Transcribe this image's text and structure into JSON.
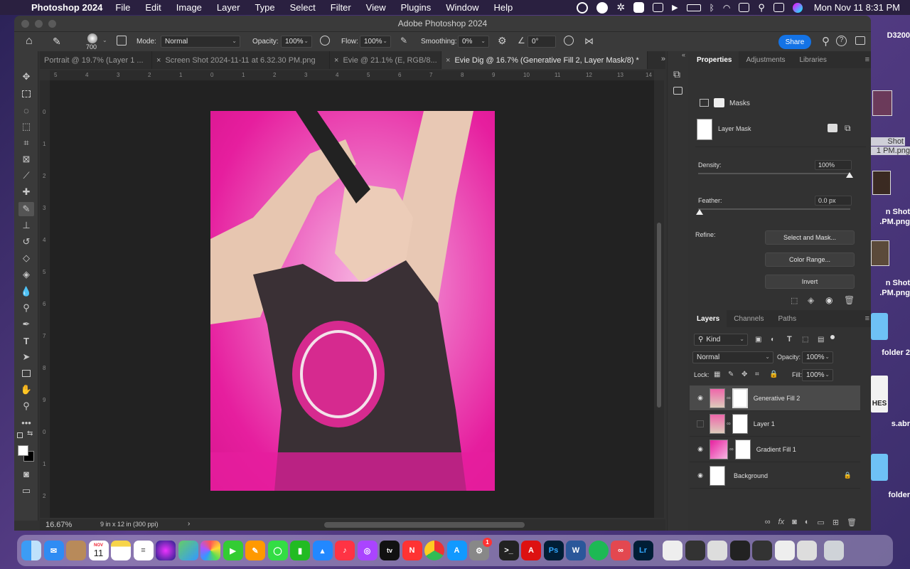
{
  "menubar": {
    "app_name": "Photoshop 2024",
    "menus": [
      "File",
      "Edit",
      "Image",
      "Layer",
      "Type",
      "Select",
      "Filter",
      "View",
      "Plugins",
      "Window",
      "Help"
    ],
    "datetime": "Mon Nov 11  8:31 PM"
  },
  "window": {
    "title": "Adobe Photoshop 2024"
  },
  "options": {
    "brush_size": "700",
    "mode_label": "Mode:",
    "mode_value": "Normal",
    "opacity_label": "Opacity:",
    "opacity_value": "100%",
    "flow_label": "Flow:",
    "flow_value": "100%",
    "smoothing_label": "Smoothing:",
    "smoothing_value": "0%",
    "angle_value": "0°",
    "share_label": "Share"
  },
  "tabs": [
    {
      "label": "Portrait @ 19.7% (Layer 1 ..."
    },
    {
      "label": "Screen Shot 2024-11-11 at 6.32.30 PM.png"
    },
    {
      "label": "Evie @ 21.1% (E, RGB/8..."
    },
    {
      "label": "Evie Dig @ 16.7% (Generative Fill 2, Layer Mask/8) *"
    }
  ],
  "ruler": {
    "h_ticks": [
      "5",
      "4",
      "3",
      "2",
      "1",
      "0",
      "1",
      "2",
      "3",
      "4",
      "5",
      "6",
      "7",
      "8",
      "9",
      "10",
      "11",
      "12",
      "13",
      "14"
    ],
    "v_ticks": [
      "0",
      "1",
      "2",
      "3",
      "4",
      "5",
      "6",
      "7",
      "8",
      "9",
      "0",
      "1",
      "2"
    ]
  },
  "status": {
    "zoom": "16.67%",
    "doc_info": "9 in x 12 in (300 ppi)"
  },
  "properties": {
    "tabs": [
      "Properties",
      "Adjustments",
      "Libraries"
    ],
    "masks_label": "Masks",
    "layer_mask_label": "Layer Mask",
    "density_label": "Density:",
    "density_value": "100%",
    "density_level": 1.0,
    "feather_label": "Feather:",
    "feather_value": "0.0 px",
    "feather_level": 0.0,
    "refine_label": "Refine:",
    "buttons": [
      "Select and Mask...",
      "Color Range...",
      "Invert"
    ]
  },
  "layers": {
    "tabs": [
      "Layers",
      "Channels",
      "Paths"
    ],
    "kind_label": "Kind",
    "blend_mode": "Normal",
    "opacity_label": "Opacity:",
    "opacity_value": "100%",
    "lock_label": "Lock:",
    "fill_label": "Fill:",
    "fill_value": "100%",
    "items": [
      {
        "name": "Generative Fill 2",
        "visible": true,
        "selected": true
      },
      {
        "name": "Layer 1",
        "visible": false,
        "selected": false
      },
      {
        "name": "Gradient Fill 1",
        "visible": true,
        "selected": false
      },
      {
        "name": "Background",
        "visible": true,
        "selected": false,
        "locked": true
      }
    ]
  },
  "desktop": {
    "items": [
      "D3200",
      "Shot",
      "1 PM.png",
      "n Shot",
      ".PM.png",
      "n Shot",
      ".PM.png",
      "folder 2",
      "HES",
      "s.abr",
      "folder"
    ]
  },
  "dock": {
    "calendar_month": "NOV",
    "calendar_day": "11",
    "badge": "1",
    "apps": [
      "finder",
      "mail",
      "contacts",
      "calendar",
      "notes",
      "reminders",
      "siri",
      "maps",
      "photos",
      "facetime",
      "pages",
      "messages",
      "numbers",
      "keynote",
      "music",
      "podcasts",
      "tv",
      "news",
      "chrome",
      "appstore",
      "settings",
      "terminal",
      "acrobat",
      "photoshop",
      "word",
      "spotify",
      "creative-cloud",
      "lightroom"
    ]
  },
  "colors": {
    "accent": "#1473e6",
    "canvas_pink": "#e61e9e",
    "panel_bg": "#323232"
  }
}
